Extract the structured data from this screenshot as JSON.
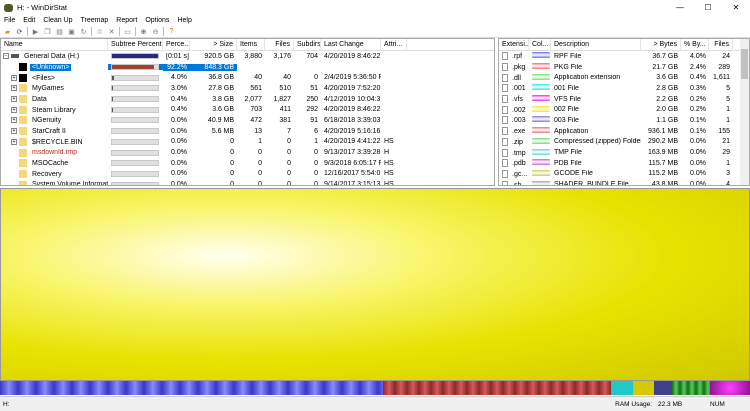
{
  "window": {
    "title": "H: - WinDirStat",
    "minimize": "—",
    "maximize": "☐",
    "close": "✕"
  },
  "menu": [
    "File",
    "Edit",
    "Clean Up",
    "Treemap",
    "Report",
    "Options",
    "Help"
  ],
  "tree": {
    "columns": [
      "Name",
      "Subtree Percent...",
      "Perce...",
      "> Size",
      "Items",
      "Files",
      "Subdirs",
      "Last Change",
      "Attri..."
    ],
    "rows": [
      {
        "name": "General Data (H:)",
        "icon": "drive",
        "expander": "-",
        "pct": "[0:01 s]",
        "fill": 100,
        "size": "920.5 GB",
        "items": "3,880",
        "files": "3,176",
        "subdirs": "704",
        "changed": "4/20/2019  8:46:22 ...",
        "attr": ""
      },
      {
        "name": "<Unknown>",
        "icon": "black",
        "expander": "",
        "pct": "92.2%",
        "fill": 92.2,
        "size": "848.3 GB",
        "items": "",
        "files": "",
        "subdirs": "",
        "changed": "",
        "attr": "",
        "selected": true
      },
      {
        "name": "<Files>",
        "icon": "black",
        "expander": "+",
        "pct": "4.0%",
        "fill": 4,
        "size": "36.8 GB",
        "items": "40",
        "files": "40",
        "subdirs": "0",
        "changed": "2/4/2019  5:36:50 P...",
        "attr": ""
      },
      {
        "name": "MyGames",
        "icon": "folder",
        "expander": "+",
        "pct": "3.0%",
        "fill": 3,
        "size": "27.8 GB",
        "items": "561",
        "files": "510",
        "subdirs": "51",
        "changed": "4/20/2019  7:52:20 ...",
        "attr": ""
      },
      {
        "name": "Data",
        "icon": "folder",
        "expander": "+",
        "pct": "0.4%",
        "fill": 0.4,
        "size": "3.8 GB",
        "items": "2,077",
        "files": "1,827",
        "subdirs": "250",
        "changed": "4/12/2019  10:04:3...",
        "attr": ""
      },
      {
        "name": "Steam Library",
        "icon": "folder",
        "expander": "+",
        "pct": "0.4%",
        "fill": 0.4,
        "size": "3.6 GB",
        "items": "703",
        "files": "411",
        "subdirs": "292",
        "changed": "4/20/2019  8:46:22 ...",
        "attr": ""
      },
      {
        "name": "NGenuity",
        "icon": "folder",
        "expander": "+",
        "pct": "0.0%",
        "fill": 0,
        "size": "40.9 MB",
        "items": "472",
        "files": "381",
        "subdirs": "91",
        "changed": "6/18/2018  3:39:03 ...",
        "attr": ""
      },
      {
        "name": "StarCraft II",
        "icon": "folder",
        "expander": "+",
        "pct": "0.0%",
        "fill": 0,
        "size": "5.6 MB",
        "items": "13",
        "files": "7",
        "subdirs": "6",
        "changed": "4/20/2019  5:16:16 ...",
        "attr": ""
      },
      {
        "name": "$RECYCLE.BIN",
        "icon": "folder",
        "expander": "+",
        "pct": "0.0%",
        "fill": 0,
        "size": "0",
        "items": "1",
        "files": "0",
        "subdirs": "1",
        "changed": "4/20/2019  4:41:22 ...",
        "attr": "HS"
      },
      {
        "name": "msdownld.tmp",
        "icon": "folder",
        "expander": "",
        "pct": "0.0%",
        "fill": 0,
        "size": "0",
        "items": "0",
        "files": "0",
        "subdirs": "0",
        "changed": "9/13/2017  3:39:28 ...",
        "attr": "H",
        "red": true
      },
      {
        "name": "MSOCache",
        "icon": "folder",
        "expander": "",
        "pct": "0.0%",
        "fill": 0,
        "size": "0",
        "items": "0",
        "files": "0",
        "subdirs": "0",
        "changed": "9/3/2018  6:05:17 P...",
        "attr": "HS"
      },
      {
        "name": "Recovery",
        "icon": "folder",
        "expander": "",
        "pct": "0.0%",
        "fill": 0,
        "size": "0",
        "items": "0",
        "files": "0",
        "subdirs": "0",
        "changed": "12/16/2017  5:54:0...",
        "attr": "HS"
      },
      {
        "name": "System Volume Information",
        "icon": "folder",
        "expander": "",
        "pct": "0.0%",
        "fill": 0,
        "size": "0",
        "items": "0",
        "files": "0",
        "subdirs": "0",
        "changed": "9/14/2017  3:15:13 ...",
        "attr": "HS"
      }
    ]
  },
  "extensions": {
    "columns": [
      "Extensi...",
      "Col...",
      "Description",
      "> Bytes",
      "% By...",
      "Files"
    ],
    "rows": [
      {
        "ext": ".rpf",
        "color": "#6b6bf0",
        "desc": "RPF File",
        "bytes": "36.7 GB",
        "pct": "4.0%",
        "files": "24"
      },
      {
        "ext": ".pkg",
        "color": "#ef6b6b",
        "desc": "PKG File",
        "bytes": "21.7 GB",
        "pct": "2.4%",
        "files": "289"
      },
      {
        "ext": ".dll",
        "color": "#6be86b",
        "desc": "Application extension",
        "bytes": "3.6 GB",
        "pct": "0.4%",
        "files": "1,611"
      },
      {
        "ext": ".001",
        "color": "#2ee6e6",
        "desc": "001 File",
        "bytes": "2.8 GB",
        "pct": "0.3%",
        "files": "5"
      },
      {
        "ext": ".vfs",
        "color": "#e62ee6",
        "desc": "VFS File",
        "bytes": "2.2 GB",
        "pct": "0.2%",
        "files": "5"
      },
      {
        "ext": ".002",
        "color": "#eaea22",
        "desc": "002 File",
        "bytes": "2.0 GB",
        "pct": "0.2%",
        "files": "1"
      },
      {
        "ext": ".003",
        "color": "#7a7ad8",
        "desc": "003 File",
        "bytes": "1.1 GB",
        "pct": "0.1%",
        "files": "1"
      },
      {
        "ext": ".exe",
        "color": "#d87a7a",
        "desc": "Application",
        "bytes": "936.1 MB",
        "pct": "0.1%",
        "files": "155"
      },
      {
        "ext": ".zip",
        "color": "#7ad87a",
        "desc": "Compressed (zipped) Folder",
        "bytes": "290.2 MB",
        "pct": "0.0%",
        "files": "21"
      },
      {
        "ext": ".tmp",
        "color": "#6ad0d0",
        "desc": "TMP File",
        "bytes": "163.9 MB",
        "pct": "0.0%",
        "files": "29"
      },
      {
        "ext": ".pdb",
        "color": "#c86ac8",
        "desc": "PDB File",
        "bytes": "115.7 MB",
        "pct": "0.0%",
        "files": "1"
      },
      {
        "ext": ".gc...",
        "color": "#cccc55",
        "desc": "GCODE File",
        "bytes": "115.2 MB",
        "pct": "0.0%",
        "files": "3"
      },
      {
        "ext": ".sh...",
        "color": "#a0a0a0",
        "desc": "SHADER_BUNDLE File",
        "bytes": "43.8 MB",
        "pct": "0.0%",
        "files": "4"
      }
    ]
  },
  "status": {
    "path": "H:",
    "ram_label": "RAM Usage:",
    "ram_value": "22.3 MB",
    "num": "NUM"
  }
}
